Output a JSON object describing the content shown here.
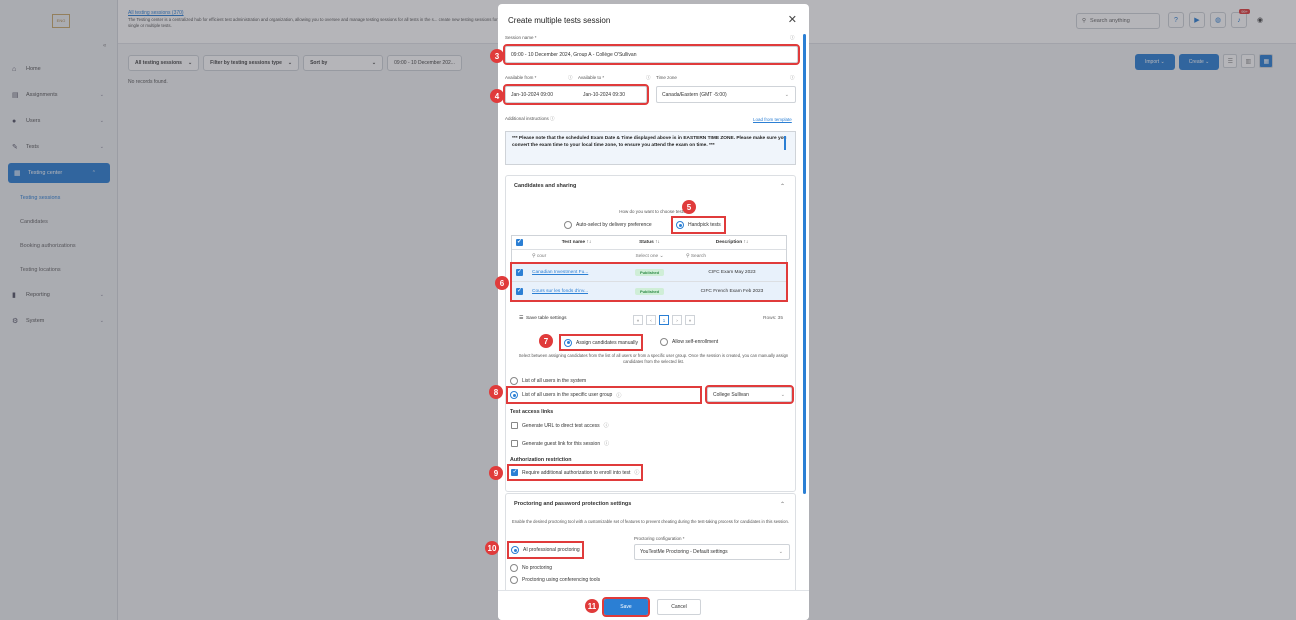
{
  "sidebar": {
    "logo_text": "ENG",
    "items": [
      {
        "icon": "home-icon",
        "glyph": "⌂",
        "label": "Home"
      },
      {
        "icon": "assignments-icon",
        "glyph": "▤",
        "label": "Assignments"
      },
      {
        "icon": "users-icon",
        "glyph": "👥",
        "label": "Users"
      },
      {
        "icon": "tests-icon",
        "glyph": "✎",
        "label": "Tests"
      },
      {
        "icon": "testing-center-icon",
        "glyph": "▦",
        "label": "Testing center"
      }
    ],
    "subitems": [
      "Testing sessions",
      "Candidates",
      "Booking authorizations",
      "Testing locations"
    ],
    "bottom_items": [
      {
        "icon": "reporting-icon",
        "glyph": "▮",
        "label": "Reporting"
      },
      {
        "icon": "system-icon",
        "glyph": "⚙",
        "label": "System"
      }
    ]
  },
  "topbar": {
    "page_link": "All testing sessions (370)",
    "description": "The Testing center is a centralized hub for efficient test administration and organization, allowing you to oversee and manage testing sessions for all tests in the s... create new testing sessions for single or multiple tests.",
    "search_placeholder": "Search anything",
    "notification_count": "99+"
  },
  "filters": {
    "all_sessions": "All testing sessions",
    "filter_type": "Filter by testing sessions type",
    "sort_by": "Sort by",
    "date_range": "09:00 - 10 December 202..."
  },
  "no_records": "No records found.",
  "actions": {
    "import": "Import",
    "create": "Create"
  },
  "modal": {
    "title": "Create multiple tests session",
    "session_name_label": "Session name *",
    "session_name_value": "09:00 - 10 December 2024, Group A - Collège O'Sullivan",
    "available_from_label": "Available from *",
    "available_from_value": "Jan-10-2024 09:00",
    "available_to_label": "Available to *",
    "available_to_value": "Jan-10-2024 09:30",
    "timezone_label": "Time zone",
    "timezone_value": "Canada/Eastern (GMT -5:00)",
    "instructions_label": "Additional instructions",
    "load_template": "Load from template",
    "instructions_text": "*** Please note that the scheduled Exam Date & Time displayed above is in EASTERN TIME ZONE. Please make sure you convert the exam time to your local time zone, to ensure you attend the exam on time. ***",
    "candidates_section": "Candidates and sharing",
    "choose_tests_question": "How do you want to choose tests?",
    "auto_select": "Auto-select by delivery preference",
    "handpick": "Handpick tests",
    "table": {
      "headers": [
        "Test name ↑↓",
        "Status ↑↓",
        "Description ↑↓"
      ],
      "filter_row": [
        "cour",
        "Select one ⌄",
        "Search"
      ],
      "rows": [
        {
          "name": "Canadian Investment Fu...",
          "status": "Published",
          "description": "CIFC Exam May 2023"
        },
        {
          "name": "Cours sur les fonds d'inv...",
          "status": "Published",
          "description": "CIFC French Exam Feb 2023"
        }
      ],
      "save_settings": "Save table settings",
      "page": "1",
      "rows_count": "Rows: 35"
    },
    "assign_manually": "Assign candidates manually",
    "allow_self": "Allow self-enrollment",
    "assign_help": "Select between assigning candidates from the list of all users or from a specific user group. Once the session is created, you can manually assign candidates from the selected list.",
    "list_all_users": "List of all users in the system",
    "list_group_users": "List of all users in the specific user group",
    "group_value": "College Sullivan",
    "test_access_links": "Test access links",
    "generate_url": "Generate URL to direct test access",
    "generate_guest": "Generate guest link for this session",
    "auth_restriction": "Authorization restriction",
    "require_auth": "Require additional authorization to enroll into test",
    "proctoring_section": "Proctoring and password protection settings",
    "proctoring_help": "Enable the desired proctoring tool with a customizable set of features to prevent cheating during the test-taking process for candidates in this session.",
    "ai_proctoring": "AI professional proctoring",
    "proctoring_config_label": "Proctoring configuration *",
    "proctoring_config_value": "YouTestMe Proctoring - Default settings",
    "no_proctoring": "No proctoring",
    "conf_proctoring": "Proctoring using conferencing tools",
    "save": "Save",
    "cancel": "Cancel"
  },
  "markers": [
    "3",
    "4",
    "5",
    "6",
    "7",
    "8",
    "9",
    "10",
    "11"
  ],
  "colors": {
    "accent": "#2b7fd4",
    "marker": "#e03b3b",
    "published_bg": "#cfeed7"
  }
}
